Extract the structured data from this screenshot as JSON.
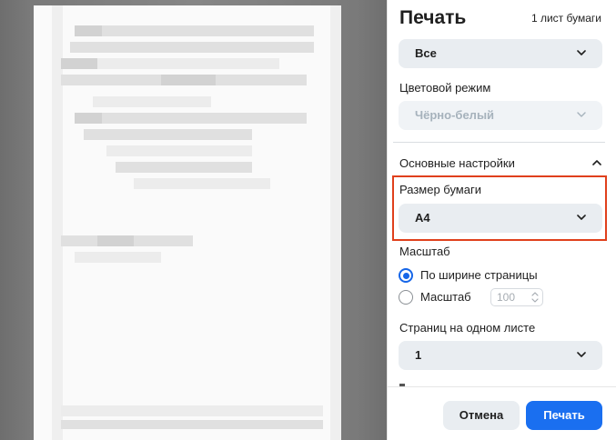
{
  "panel": {
    "title": "Печать",
    "sheet_count": "1 лист бумаги"
  },
  "pages_select": {
    "value": "Все",
    "icon": "chevron-down-icon"
  },
  "color_mode": {
    "label": "Цветовой режим",
    "value": "Чёрно-белый",
    "disabled": true
  },
  "basic_settings": {
    "label": "Основные настройки",
    "expanded": true
  },
  "paper_size": {
    "label": "Размер бумаги",
    "value": "A4",
    "highlight_color": "#e0401c"
  },
  "scale": {
    "label": "Масштаб",
    "options": [
      {
        "label": "По ширине страницы",
        "checked": true
      },
      {
        "label": "Масштаб",
        "checked": false
      }
    ],
    "custom_value": "100"
  },
  "pages_per_sheet": {
    "label": "Страниц на одном листе",
    "value": "1"
  },
  "buttons": {
    "cancel": "Отмена",
    "print": "Печать"
  },
  "colors": {
    "accent": "#1a6ff0",
    "select_bg": "#e9edf1",
    "preview_bg": "#808080"
  }
}
